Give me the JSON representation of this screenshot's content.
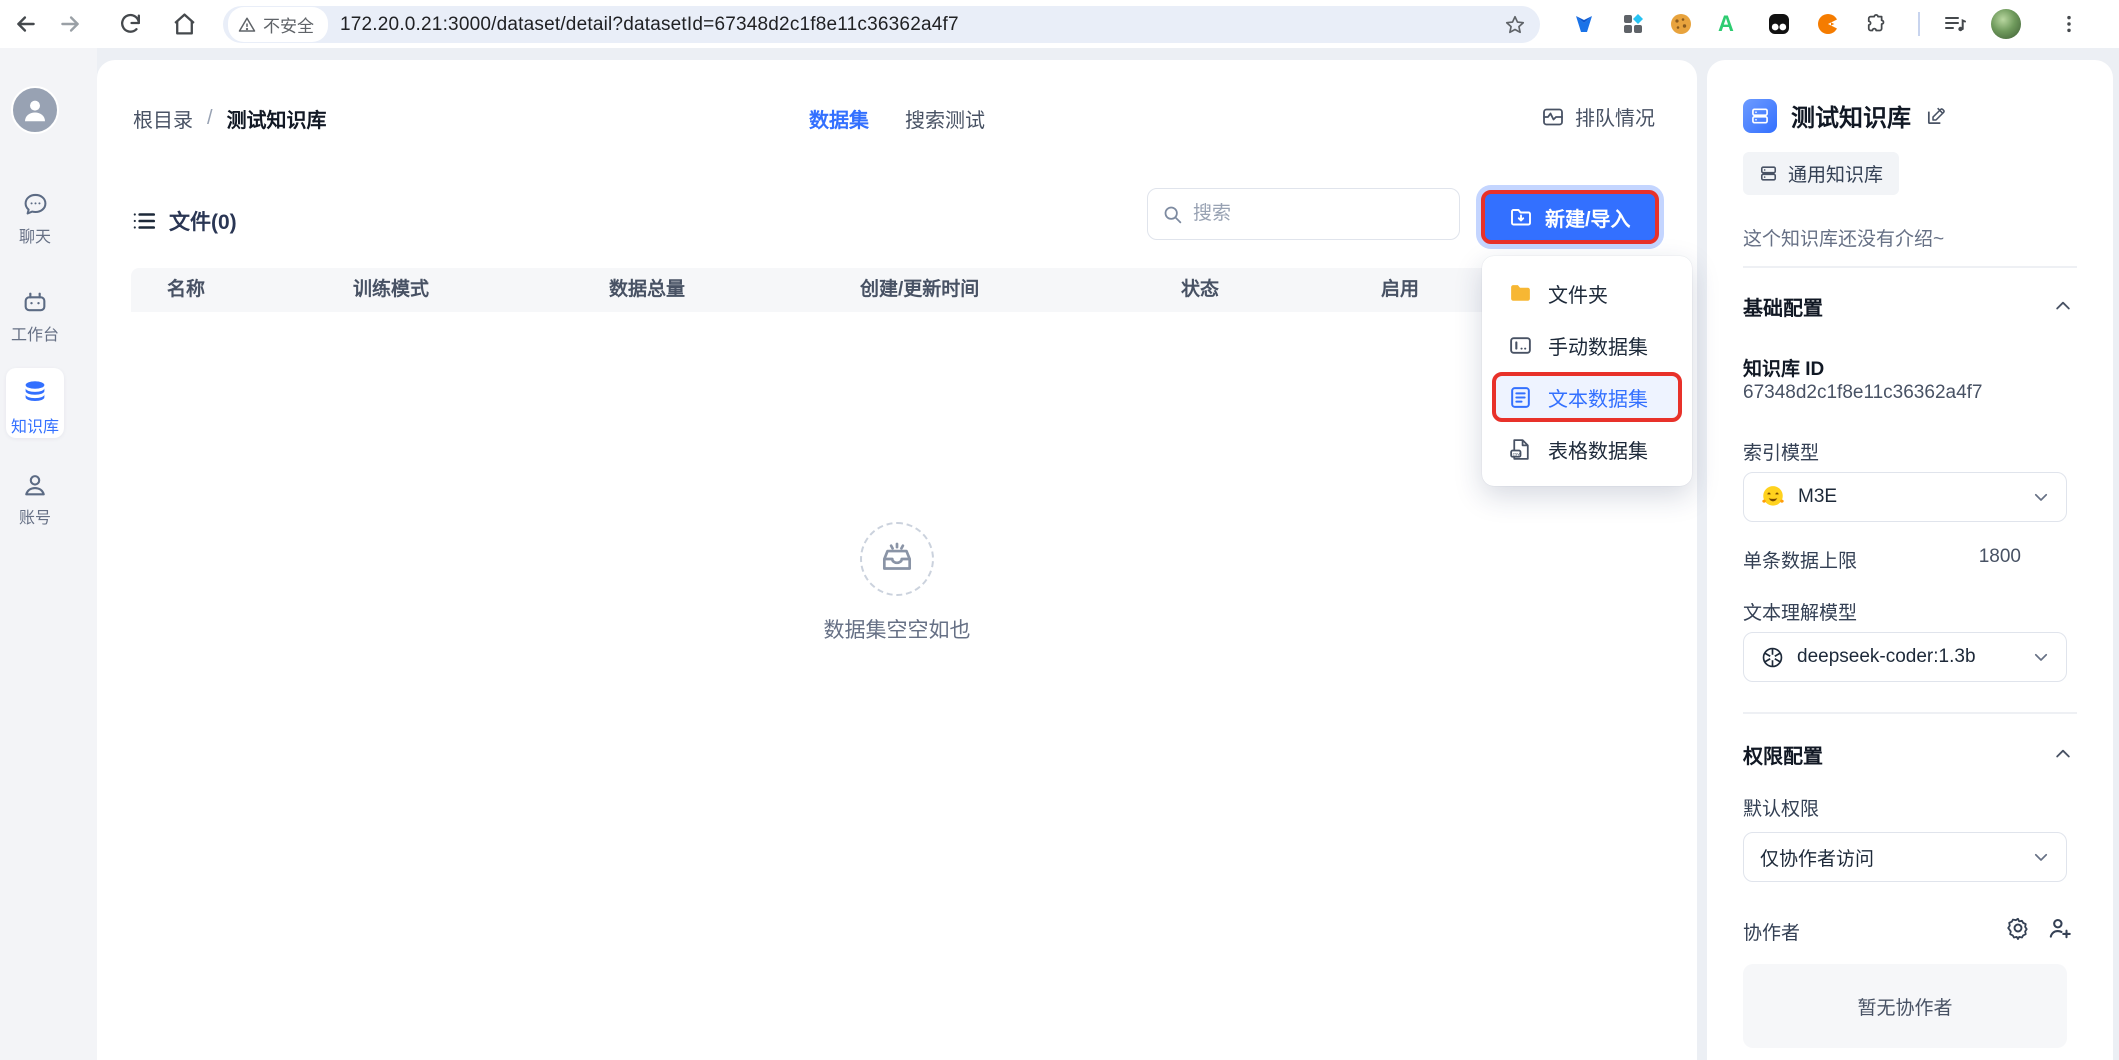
{
  "browser": {
    "security_chip": "不安全",
    "url": "172.20.0.21:3000/dataset/detail?datasetId=67348d2c1f8e11c36362a4f7"
  },
  "sidebar": {
    "items": [
      {
        "label": "聊天"
      },
      {
        "label": "工作台"
      },
      {
        "label": "知识库",
        "active": true
      },
      {
        "label": "账号"
      }
    ]
  },
  "header": {
    "breadcrumb_root": "根目录",
    "breadcrumb_sep": "/",
    "breadcrumb_current": "测试知识库",
    "tabs": [
      {
        "label": "数据集"
      },
      {
        "label": "搜索测试"
      }
    ],
    "queue_button": "排队情况"
  },
  "files": {
    "title": "文件(0)",
    "search_placeholder": "搜索",
    "create_button": "新建/导入",
    "menu": [
      {
        "label": "文件夹"
      },
      {
        "label": "手动数据集"
      },
      {
        "label": "文本数据集",
        "highlighted": true
      },
      {
        "label": "表格数据集"
      }
    ],
    "table_headers": [
      "名称",
      "训练模式",
      "数据总量",
      "创建/更新时间",
      "状态",
      "启用"
    ],
    "empty_text": "数据集空空如也"
  },
  "details": {
    "title": "测试知识库",
    "type_tag": "通用知识库",
    "description": "这个知识库还没有介绍~",
    "base_section": "基础配置",
    "id_label": "知识库 ID",
    "id_value": "67348d2c1f8e11c36362a4f7",
    "index_model_label": "索引模型",
    "index_model_value": "M3E",
    "max_chunk_label": "单条数据上限",
    "max_chunk_value": "1800",
    "text_model_label": "文本理解模型",
    "text_model_value": "deepseek-coder:1.3b",
    "perm_section": "权限配置",
    "default_perm_label": "默认权限",
    "default_perm_value": "仅协作者访问",
    "collab_label": "协作者",
    "collab_empty": "暂无协作者"
  },
  "icons": {
    "menu_item_icons": [
      "folder-icon",
      "manual-dataset-icon",
      "text-dataset-icon",
      "csv-dataset-icon"
    ],
    "index_model_icon": "huggingface-icon",
    "text_model_icon": "openai-icon"
  },
  "colors": {
    "accent_blue": "#3370FF",
    "annotation_red": "#E8312A",
    "folder_yellow": "#F7B733",
    "page_background": "#ECEFF4",
    "gray_text": "#667085"
  }
}
